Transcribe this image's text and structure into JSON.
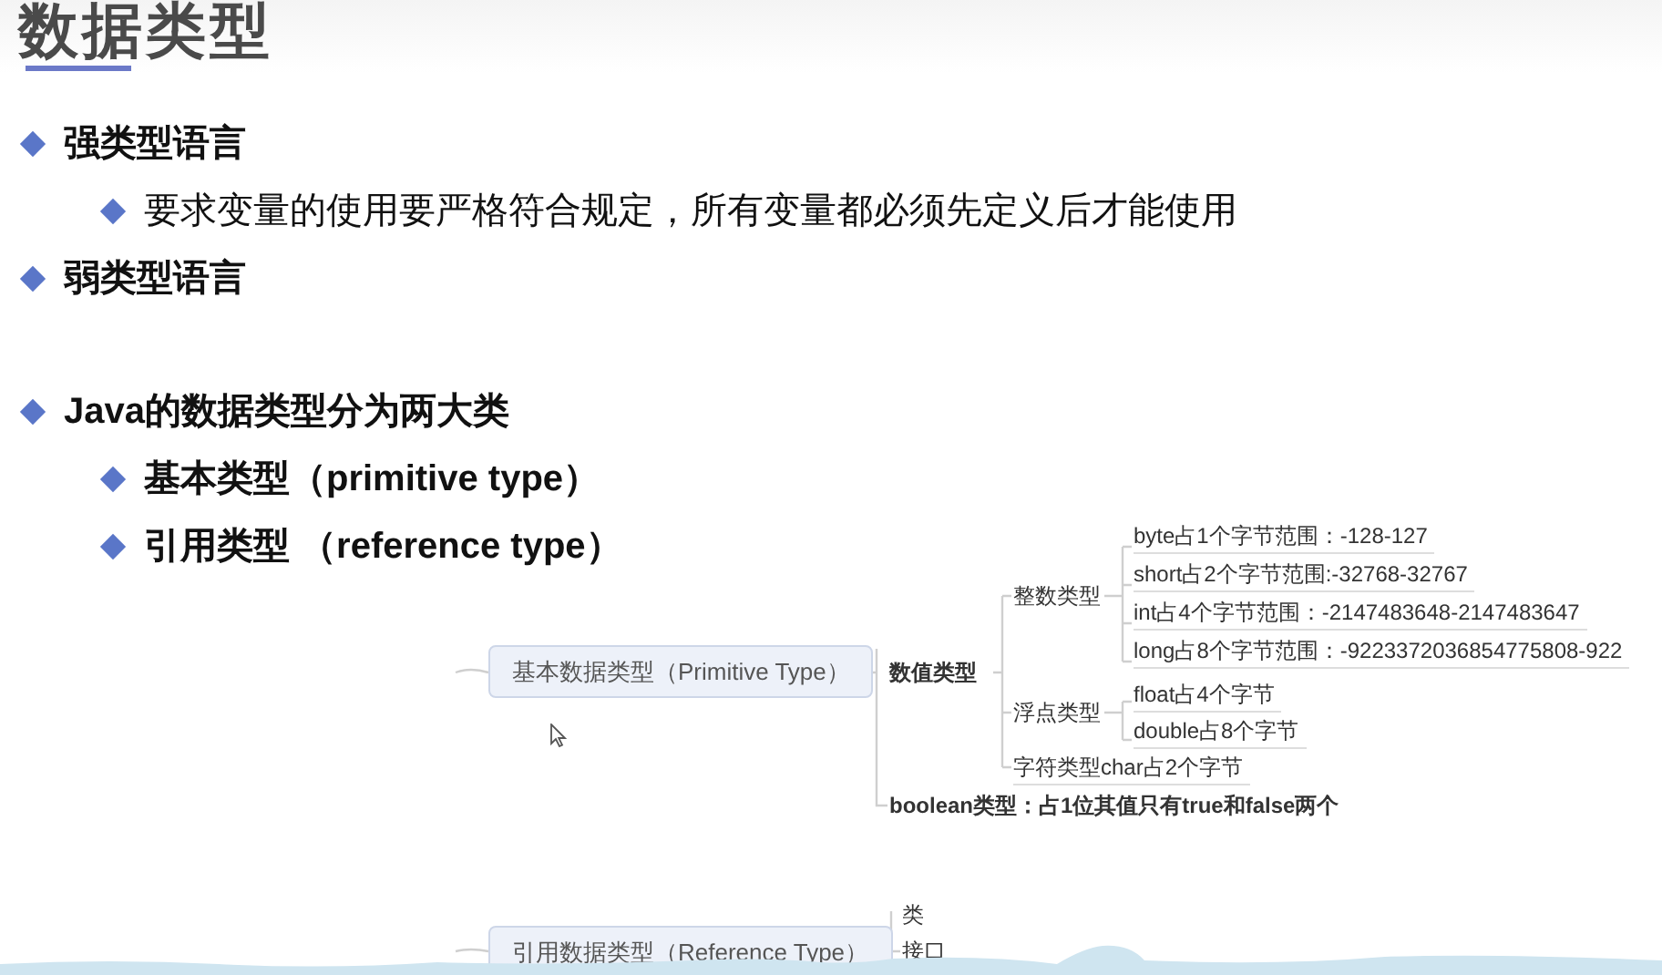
{
  "title": "数据类型",
  "sections": [
    [
      {
        "text": "强类型语言",
        "bold": true,
        "children": [
          {
            "text": "要求变量的使用要严格符合规定，所有变量都必须先定义后才能使用",
            "bold": false
          }
        ]
      },
      {
        "text": "弱类型语言",
        "bold": true
      }
    ],
    [
      {
        "text": "Java的数据类型分为两大类",
        "bold": true,
        "children": [
          {
            "text": "基本类型（primitive type）",
            "bold": true
          },
          {
            "text": "引用类型 （reference type）",
            "bold": true
          }
        ]
      }
    ]
  ],
  "mindmap": [
    {
      "text": "基本数据类型（Primitive Type）",
      "kind": "box"
    },
    {
      "text": "数值类型",
      "kind": "bold"
    },
    {
      "text": "整数类型",
      "kind": "label"
    },
    {
      "text": "byte占1个字节范围：-128-127",
      "kind": "leaf"
    },
    {
      "text": "short占2个字节范围:-32768-32767",
      "kind": "leaf"
    },
    {
      "text": "int占4个字节范围：-2147483648-2147483647",
      "kind": "leaf"
    },
    {
      "text": "long占8个字节范围：-9223372036854775808-922",
      "kind": "leaf"
    },
    {
      "text": "浮点类型",
      "kind": "label"
    },
    {
      "text": "float占4个字节",
      "kind": "leaf"
    },
    {
      "text": "double占8个字节",
      "kind": "leaf"
    },
    {
      "text": "字符类型char占2个字节",
      "kind": "leaf"
    },
    {
      "text": "boolean类型：占1位其值只有true和false两个",
      "kind": "bold"
    },
    {
      "text": "引用数据类型（Reference Type）",
      "kind": "box"
    },
    {
      "text": "类",
      "kind": "label"
    },
    {
      "text": "接口",
      "kind": "label"
    }
  ]
}
